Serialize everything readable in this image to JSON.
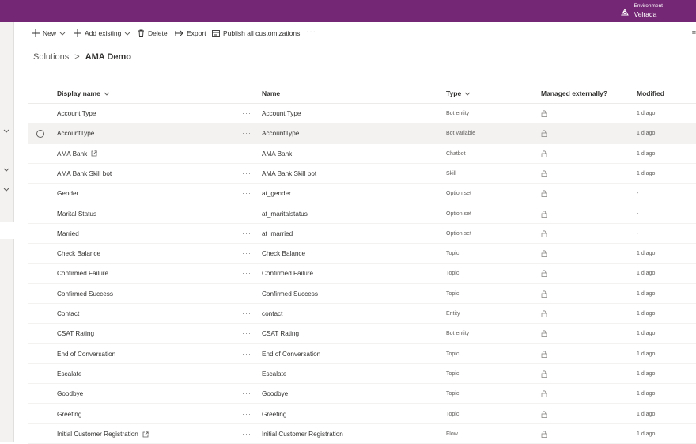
{
  "env": {
    "label": "Environment",
    "value": "Velrada"
  },
  "cmd": {
    "new": "New",
    "add_existing": "Add existing",
    "delete": "Delete",
    "export": "Export",
    "publish": "Publish all customizations",
    "more": "···",
    "right": "≡"
  },
  "breadcrumb": {
    "root": "Solutions",
    "sep": ">",
    "current": "AMA Demo"
  },
  "columns": {
    "display_name": "Display name",
    "name": "Name",
    "type": "Type",
    "managed": "Managed externally?",
    "modified": "Modified"
  },
  "rows": [
    {
      "display": "Account Type",
      "more": "···",
      "name": "Account Type",
      "type": "Bot entity",
      "modified": "1 d ago"
    },
    {
      "display": "AccountType",
      "more": "···",
      "name": "AccountType",
      "type": "Bot variable",
      "modified": "1 d ago"
    },
    {
      "display": "AMA Bank",
      "more": "···",
      "name": "AMA Bank",
      "type": "Chatbot",
      "modified": "1 d ago"
    },
    {
      "display": "AMA Bank Skill bot",
      "more": "···",
      "name": "AMA Bank Skill bot",
      "type": "Skill",
      "modified": "1 d ago"
    },
    {
      "display": "Gender",
      "more": "···",
      "name": "at_gender",
      "type": "Option set",
      "modified": "-"
    },
    {
      "display": "Marital Status",
      "more": "···",
      "name": "at_maritalstatus",
      "type": "Option set",
      "modified": "-"
    },
    {
      "display": "Married",
      "more": "···",
      "name": "at_married",
      "type": "Option set",
      "modified": "-"
    },
    {
      "display": "Check Balance",
      "more": "···",
      "name": "Check Balance",
      "type": "Topic",
      "modified": "1 d ago"
    },
    {
      "display": "Confirmed Failure",
      "more": "···",
      "name": "Confirmed Failure",
      "type": "Topic",
      "modified": "1 d ago"
    },
    {
      "display": "Confirmed Success",
      "more": "···",
      "name": "Confirmed Success",
      "type": "Topic",
      "modified": "1 d ago"
    },
    {
      "display": "Contact",
      "more": "···",
      "name": "contact",
      "type": "Entity",
      "modified": "1 d ago"
    },
    {
      "display": "CSAT Rating",
      "more": "···",
      "name": "CSAT Rating",
      "type": "Bot entity",
      "modified": "1 d ago"
    },
    {
      "display": "End of Conversation",
      "more": "···",
      "name": "End of Conversation",
      "type": "Topic",
      "modified": "1 d ago"
    },
    {
      "display": "Escalate",
      "more": "···",
      "name": "Escalate",
      "type": "Topic",
      "modified": "1 d ago"
    },
    {
      "display": "Goodbye",
      "more": "···",
      "name": "Goodbye",
      "type": "Topic",
      "modified": "1 d ago"
    },
    {
      "display": "Greeting",
      "more": "···",
      "name": "Greeting",
      "type": "Topic",
      "modified": "1 d ago"
    },
    {
      "display": "Initial Customer Registration",
      "more": "···",
      "name": "Initial Customer Registration",
      "type": "Flow",
      "modified": "1 d ago"
    }
  ],
  "selected_row": "AccountType",
  "icons": [
    "environment-icon",
    "plus-icon",
    "chevron-down-icon",
    "trash-icon",
    "arrow-export-icon",
    "publish-icon",
    "external-link-icon",
    "lock-icon"
  ],
  "colors": {
    "header": "#742774",
    "selected_row": "#f3f2f1"
  }
}
